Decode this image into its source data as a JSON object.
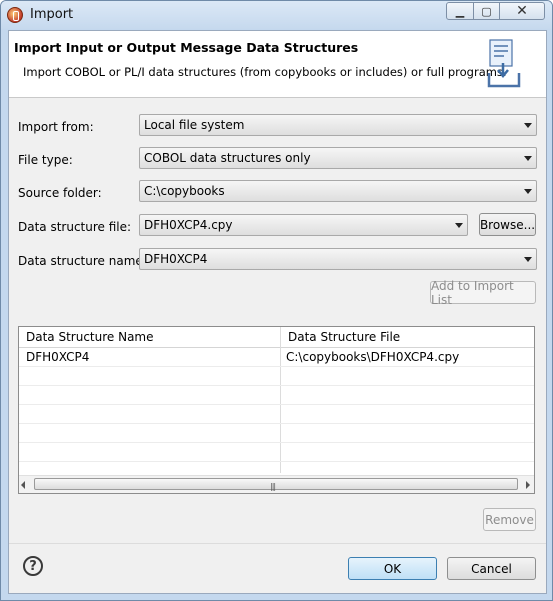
{
  "window": {
    "title": "Import"
  },
  "header": {
    "title": "Import Input or Output Message Data Structures",
    "description": "Import COBOL or PL/I data structures (from copybooks or includes) or full programs."
  },
  "form": {
    "import_from": {
      "label": "Import from:",
      "value": "Local file system"
    },
    "file_type": {
      "label": "File type:",
      "value": "COBOL data structures only"
    },
    "source_folder": {
      "label": "Source folder:",
      "value": "C:\\copybooks"
    },
    "data_structure_file": {
      "label": "Data structure file:",
      "value": "DFH0XCP4.cpy",
      "browse_label": "Browse..."
    },
    "data_structure_name": {
      "label": "Data structure name:",
      "value": "DFH0XCP4"
    },
    "add_label": "Add to Import List"
  },
  "table": {
    "columns": [
      "Data Structure Name",
      "Data Structure File"
    ],
    "rows": [
      {
        "name": "DFH0XCP4",
        "file": "C:\\copybooks\\DFH0XCP4.cpy"
      }
    ],
    "remove_label": "Remove"
  },
  "footer": {
    "ok_label": "OK",
    "cancel_label": "Cancel"
  },
  "icons": {
    "app": "import-app-icon",
    "header": "import-wizard-icon",
    "help": "help-icon"
  },
  "colors": {
    "titlebar": "#c6d9ee",
    "dialog_bg": "#f0f0f0",
    "default_button": "#bfe0f6"
  }
}
